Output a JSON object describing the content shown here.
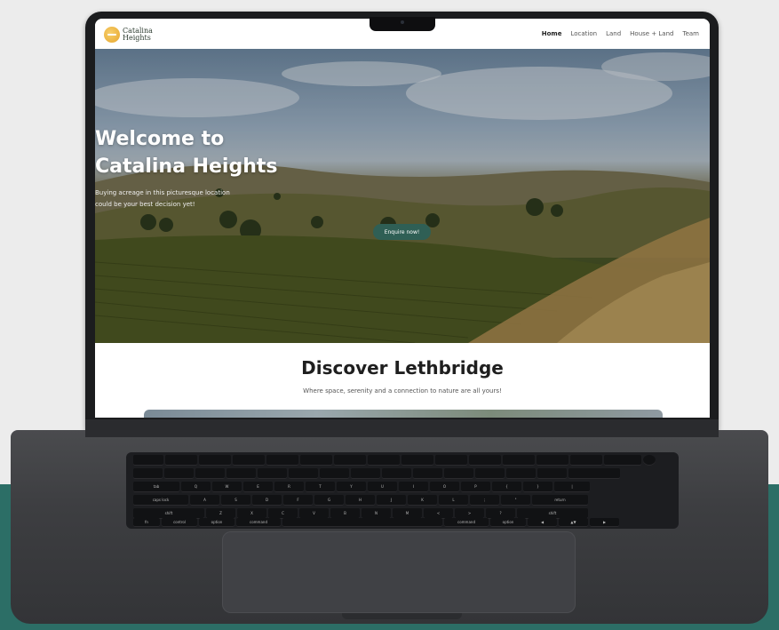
{
  "logo": {
    "line1": "Catalina",
    "line2": "Heights",
    "icon": "sun-logo-icon"
  },
  "nav": {
    "items": [
      "Home",
      "Location",
      "Land",
      "House + Land",
      "Team"
    ],
    "active": "Home"
  },
  "hero": {
    "title_line1": "Welcome to",
    "title_line2": "Catalina Heights",
    "subtitle_line1": "Buying acreage in this picturesque location",
    "subtitle_line2": "could be your best decision yet!",
    "cta_label": "Enquire now!"
  },
  "discover": {
    "title": "Discover Lethbridge",
    "subtitle": "Where space, serenity and a connection to nature are all yours!"
  },
  "keyboard": {
    "row_tab": [
      "tab",
      "Q",
      "W",
      "E",
      "R",
      "T",
      "Y",
      "U",
      "I",
      "O",
      "P",
      "{",
      "}",
      "|"
    ],
    "row_caps": [
      "caps lock",
      "A",
      "S",
      "D",
      "F",
      "G",
      "H",
      "J",
      "K",
      "L",
      ";",
      "\"",
      "return"
    ],
    "row_shift": [
      "shift",
      "Z",
      "X",
      "C",
      "V",
      "B",
      "N",
      "M",
      "<",
      ">",
      "?",
      "shift"
    ],
    "row_bottom": [
      "fn",
      "control",
      "option",
      "command",
      "",
      "command",
      "option",
      "◀",
      "▲▼",
      "▶"
    ]
  },
  "colors": {
    "accent": "#2f5f55",
    "teal_band": "#2c6e66",
    "laptop": "#3d3e41"
  }
}
